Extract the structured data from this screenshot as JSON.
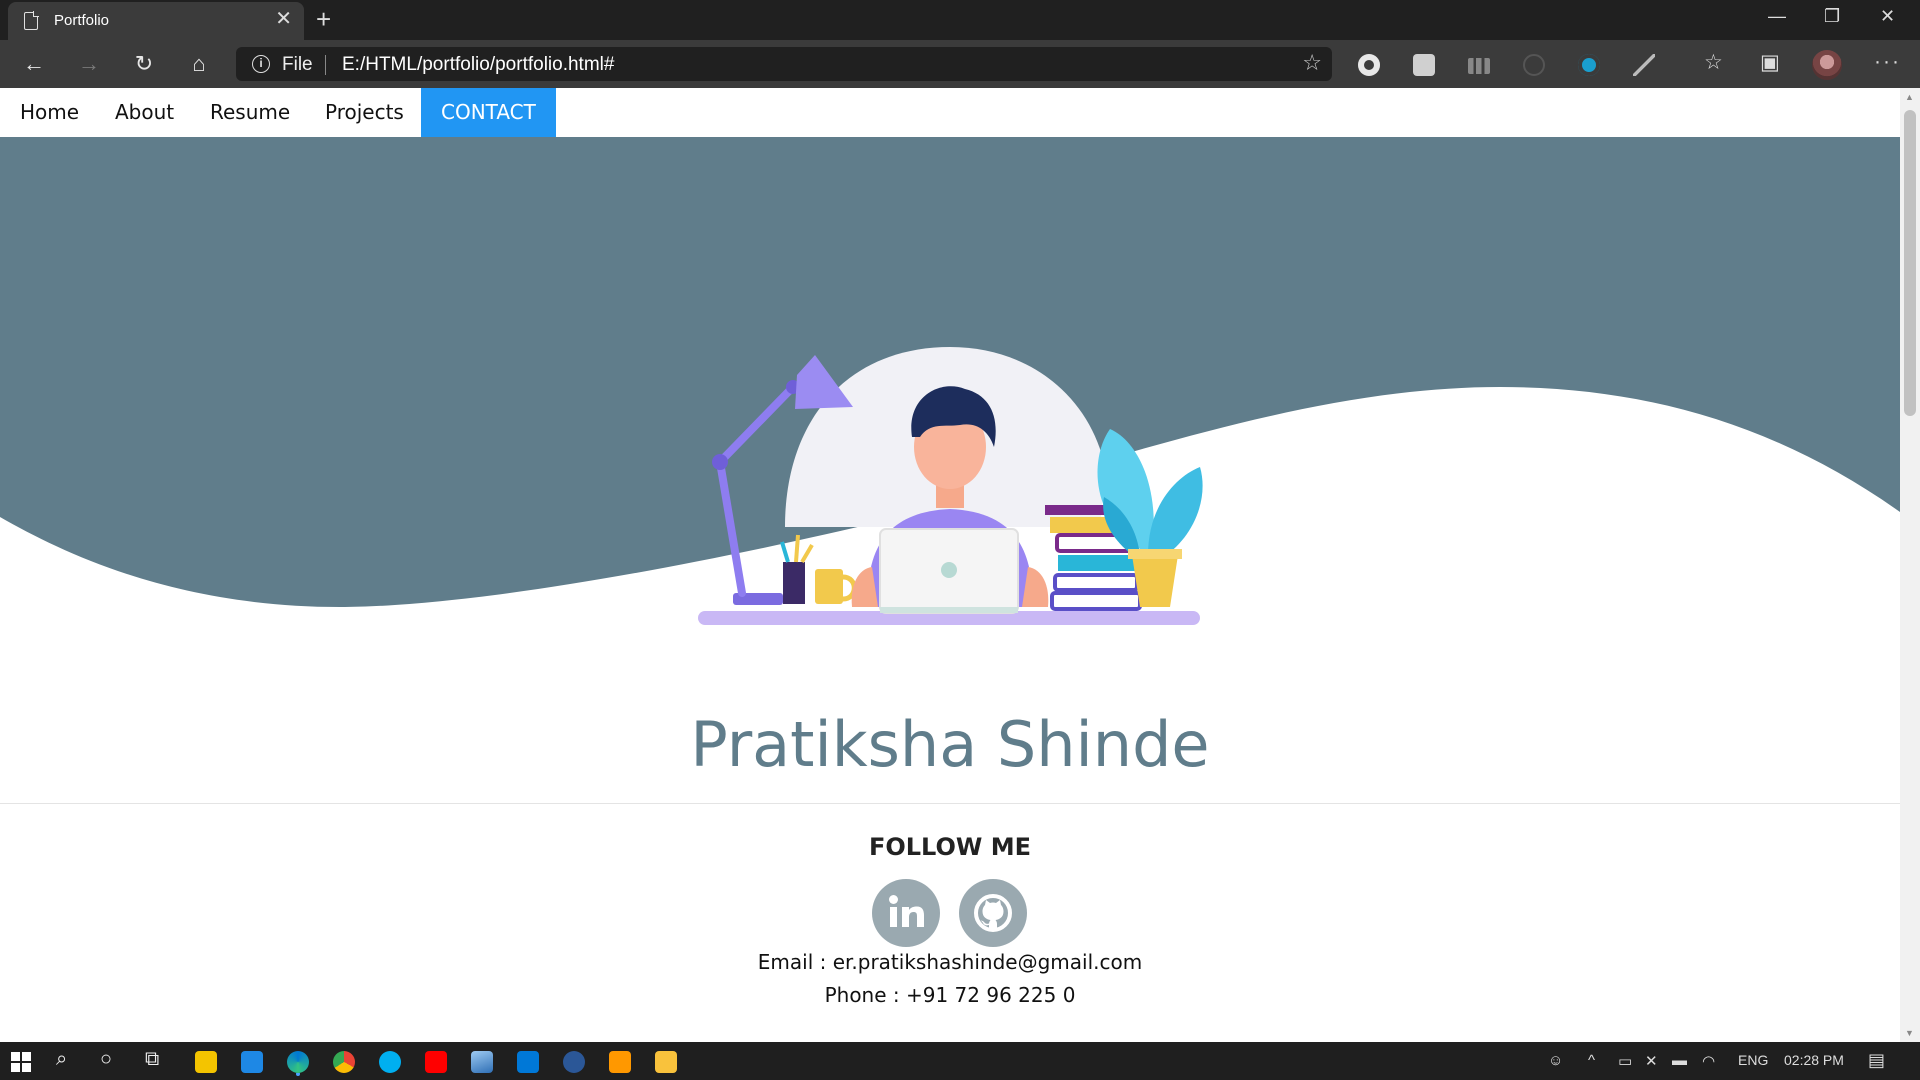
{
  "browser": {
    "tab_title": "Portfolio",
    "address_scheme": "File",
    "url": "E:/HTML/portfolio/portfolio.html#"
  },
  "site": {
    "nav": [
      {
        "label": "Home",
        "active": false
      },
      {
        "label": "About",
        "active": false
      },
      {
        "label": "Resume",
        "active": false
      },
      {
        "label": "Projects",
        "active": false
      },
      {
        "label": "CONTACT",
        "active": true
      }
    ],
    "name": "Pratiksha Shinde",
    "follow_heading": "FOLLOW ME",
    "social": [
      {
        "icon": "linkedin-icon",
        "label": "in"
      },
      {
        "icon": "github-icon"
      }
    ],
    "email": "Email : er.pratikshashinde@gmail.com",
    "phone": "Phone : +91 72  96 225  0",
    "colors": {
      "hero": "#607d8b",
      "accent": "#2196f3",
      "social": "#9aa9b0"
    }
  },
  "taskbar": {
    "language": "ENG",
    "time": "02:28 PM"
  }
}
